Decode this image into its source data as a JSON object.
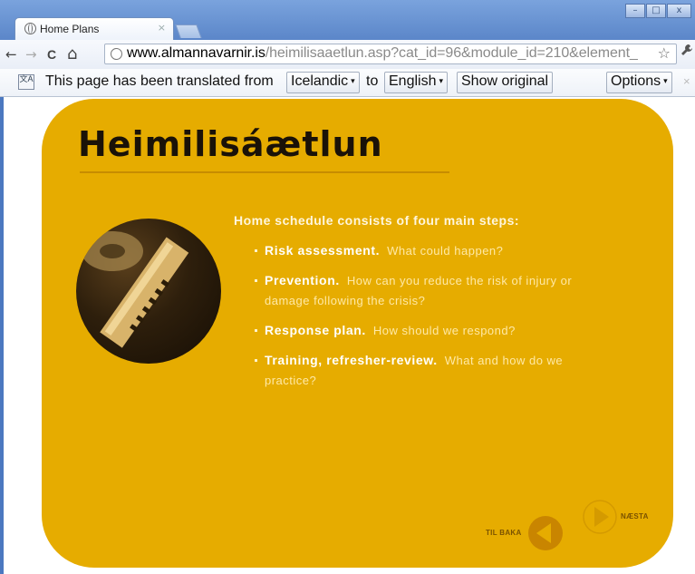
{
  "browser": {
    "tab_title": "Home Plans",
    "tab_close": "×",
    "window_controls": [
      "–",
      "□",
      "x"
    ],
    "url_host": "www.almannavarnir.is",
    "url_path": "/heimilisaaetlun.asp?cat_id=96&module_id=210&element_",
    "nav": {
      "back": "←",
      "forward": "→",
      "reload": "C",
      "home": "⌂"
    },
    "star": "☆",
    "wrench": "🔧"
  },
  "translate_bar": {
    "icon_text": "文A",
    "prefix": "This page has been translated from",
    "from_language": "Icelandic",
    "connector": "to",
    "to_language": "English",
    "show_original_label": "Show original",
    "options_label": "Options",
    "close": "×"
  },
  "page": {
    "heading": "Heimilisáætlun",
    "intro": "Home schedule consists of four main steps:",
    "steps": [
      {
        "title": "Risk assessment.",
        "question": "What could happen?"
      },
      {
        "title": "Prevention.",
        "question": "How can you reduce the risk of injury or damage following the crisis?"
      },
      {
        "title": "Response plan.",
        "question": "How should we respond?"
      },
      {
        "title": "Training, refresher-review.",
        "question": "What and how do we practice?"
      }
    ],
    "nav_back_label": "TIL BAKA",
    "nav_next_label": "NÆSTA"
  },
  "colors": {
    "card": "#e6ac00",
    "heading": "#1a1208",
    "chrome_frame": "#5b86c9"
  }
}
